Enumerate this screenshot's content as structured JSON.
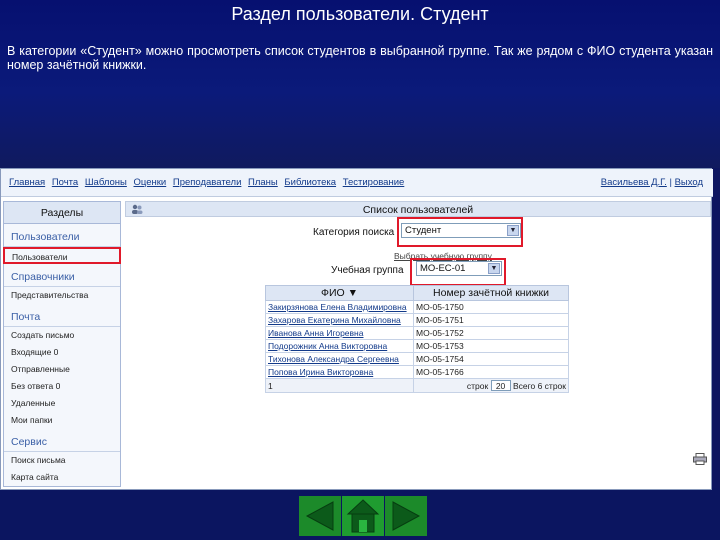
{
  "slide": {
    "title": "Раздел пользователи. Студент",
    "text": "В категории «Студент» можно просмотреть список студентов в выбранной группе. Так же рядом с ФИО студента указан номер зачётной книжки."
  },
  "topnav": {
    "items": [
      "Главная",
      "Почта",
      "Шаблоны",
      "Оценки",
      "Преподаватели",
      "Планы",
      "Библиотека",
      "Тестирование"
    ],
    "user": "Васильева Д.Г.",
    "separator": " | ",
    "logout": "Выход"
  },
  "sidebar": {
    "header": "Разделы",
    "sections": [
      {
        "title": "Пользователи",
        "items": [
          "Пользователи"
        ]
      },
      {
        "title": "Справочники",
        "items": [
          "Представительства"
        ]
      },
      {
        "title": "Почта",
        "items": [
          "Создать письмо",
          "Входящие 0",
          "Отправленные",
          "Без ответа 0",
          "Удаленные",
          "Мои папки"
        ]
      },
      {
        "title": "Сервис",
        "items": [
          "Поиск письма",
          "Карта сайта"
        ]
      }
    ]
  },
  "main": {
    "title": "Список пользователей",
    "category_label": "Категория поиска",
    "category_value": "Студент",
    "group_hint": "Выбрать учебную группу",
    "group_label": "Учебная группа",
    "group_value": "МО-ЕС-01"
  },
  "table": {
    "headers": [
      "ФИО ▼",
      "Номер зачётной книжки"
    ],
    "rows": [
      [
        "Закирзянова Елена Владимировна",
        "МО-05-1750"
      ],
      [
        "Захарова Екатерина Михайловна",
        "МО-05-1751"
      ],
      [
        "Иванова Анна Игоревна",
        "МО-05-1752"
      ],
      [
        "Подорожник Анна Викторовна",
        "МО-05-1753"
      ],
      [
        "Тихонова Александра Сергеевна",
        "МО-05-1754"
      ],
      [
        "Попова Ирина Викторовна",
        "МО-05-1766"
      ]
    ],
    "pager_page": "1",
    "pager_label": "строк",
    "pager_size": "20",
    "pager_total": "Всего 6 строк"
  },
  "colors": {
    "highlight": "#e0192a",
    "nav_green": "#1c8a2a",
    "slide_bg": "#0d1560"
  }
}
